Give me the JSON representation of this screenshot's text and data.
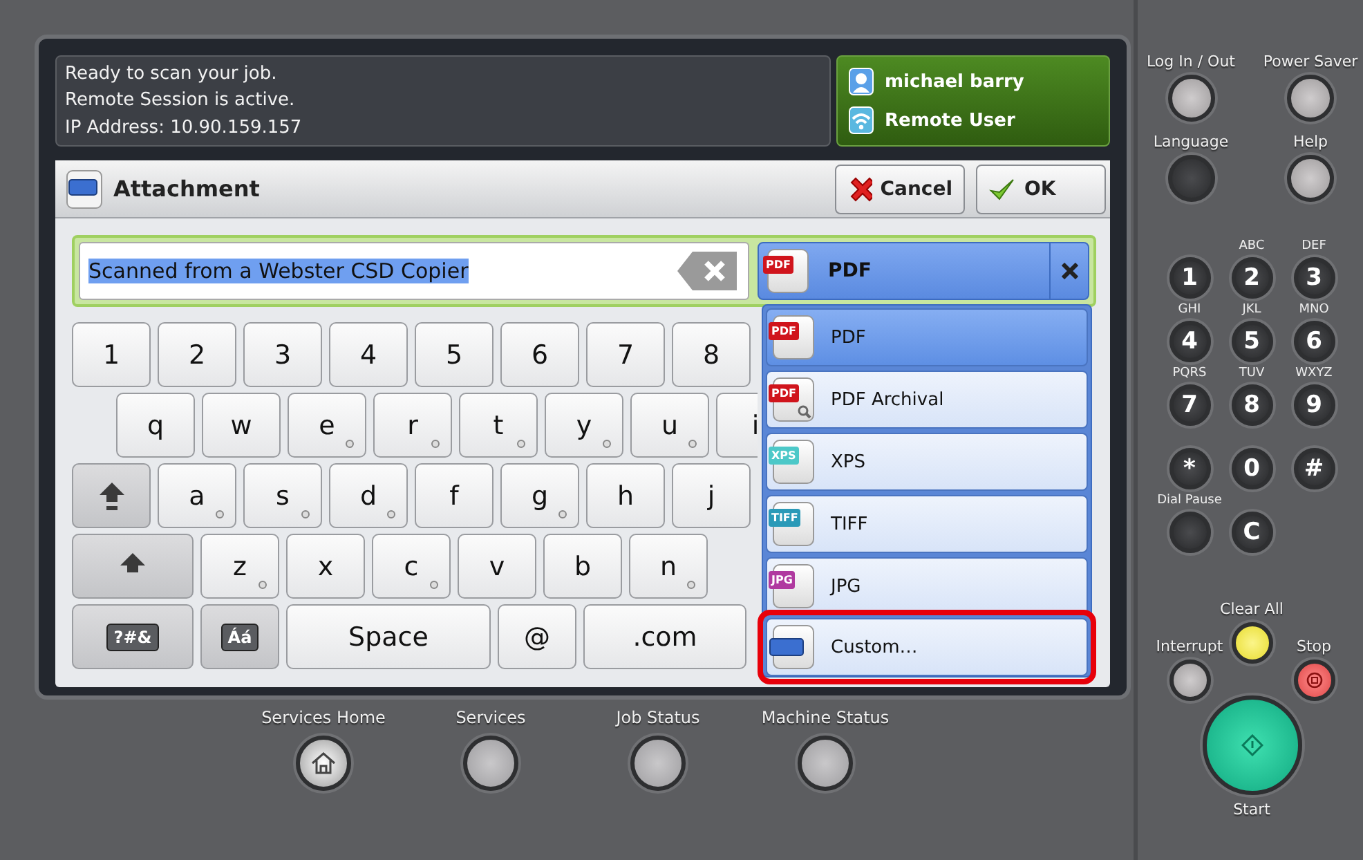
{
  "status": {
    "lines": [
      "Ready to scan your job.",
      "Remote Session is active.",
      "IP Address: 10.90.159.157"
    ]
  },
  "user": {
    "name": "michael barry",
    "role": "Remote User"
  },
  "dialog": {
    "title": "Attachment",
    "buttons": [
      {
        "label": "Cancel",
        "kind": "cancel"
      },
      {
        "label": "OK",
        "kind": "ok"
      }
    ]
  },
  "filename": {
    "value": "Scanned from a Webster CSD Copier",
    "selected": true
  },
  "format": {
    "value": "PDF",
    "badge": "PDF",
    "kind": "pdf"
  },
  "format_options": [
    {
      "label": "PDF",
      "badge": "PDF",
      "kind": "pdf",
      "selected": true,
      "highlighted": false
    },
    {
      "label": "PDF Archival",
      "badge": "PDF",
      "kind": "pdf-archival",
      "selected": false,
      "highlighted": false
    },
    {
      "label": "XPS",
      "badge": "XPS",
      "kind": "xps",
      "selected": false,
      "highlighted": false
    },
    {
      "label": "TIFF",
      "badge": "TIFF",
      "kind": "tiff",
      "selected": false,
      "highlighted": false
    },
    {
      "label": "JPG",
      "badge": "JPG",
      "kind": "jpg",
      "selected": false,
      "highlighted": false
    },
    {
      "label": "Custom…",
      "kind": "custom",
      "selected": false,
      "highlighted": true
    }
  ],
  "keyboard": [
    {
      "keys": [
        {
          "label": "1"
        },
        {
          "label": "2"
        },
        {
          "label": "3"
        },
        {
          "label": "4"
        },
        {
          "label": "5"
        },
        {
          "label": "6"
        },
        {
          "label": "7"
        },
        {
          "label": "8"
        }
      ]
    },
    {
      "keys": [
        {
          "label": "q"
        },
        {
          "label": "w"
        },
        {
          "label": "e",
          "accent": true
        },
        {
          "label": "r",
          "accent": true
        },
        {
          "label": "t",
          "accent": true
        },
        {
          "label": "y",
          "accent": true
        },
        {
          "label": "u",
          "accent": true
        },
        {
          "label": "i"
        }
      ]
    },
    {
      "keys": [
        {
          "kind": "shift-lock"
        },
        {
          "label": "a",
          "accent": true
        },
        {
          "label": "s",
          "accent": true
        },
        {
          "label": "d",
          "accent": true
        },
        {
          "label": "f"
        },
        {
          "label": "g",
          "accent": true
        },
        {
          "label": "h"
        },
        {
          "label": "j"
        }
      ]
    },
    {
      "keys": [
        {
          "kind": "shift"
        },
        {
          "label": "z",
          "accent": true
        },
        {
          "label": "x"
        },
        {
          "label": "c",
          "accent": true
        },
        {
          "label": "v"
        },
        {
          "label": "b"
        },
        {
          "label": "n",
          "accent": true
        }
      ]
    },
    {
      "keys": [
        {
          "label": "?#&",
          "kind": "symbols"
        },
        {
          "label": "Áá",
          "kind": "accents"
        },
        {
          "label": "Space",
          "kind": "space"
        },
        {
          "label": "@"
        },
        {
          "label": ".com",
          "kind": "domain"
        }
      ]
    }
  ],
  "top_buttons": [
    {
      "label": "Log In / Out",
      "kind": "light"
    },
    {
      "label": "Power Saver",
      "kind": "light"
    },
    {
      "label": "Language",
      "kind": "dark"
    },
    {
      "label": "Help",
      "kind": "light"
    }
  ],
  "keypad": [
    {
      "key": "1"
    },
    {
      "key": "2",
      "letters": "ABC"
    },
    {
      "key": "3",
      "letters": "DEF"
    },
    {
      "key": "4",
      "letters": "GHI"
    },
    {
      "key": "5",
      "letters": "JKL"
    },
    {
      "key": "6",
      "letters": "MNO"
    },
    {
      "key": "7",
      "letters": "PQRS"
    },
    {
      "key": "8",
      "letters": "TUV"
    },
    {
      "key": "9",
      "letters": "WXYZ"
    },
    {
      "key": "*"
    },
    {
      "key": "0"
    },
    {
      "key": "#"
    },
    {
      "letters": "Dial Pause"
    },
    {
      "key": "C"
    }
  ],
  "action_buttons": [
    {
      "label": "Interrupt",
      "kind": "interrupt"
    },
    {
      "label": "Clear All",
      "kind": "clear"
    },
    {
      "label": "Stop",
      "kind": "stop"
    },
    {
      "label": "Start",
      "kind": "start"
    }
  ],
  "bottom_buttons": [
    {
      "label": "Services Home",
      "kind": "home"
    },
    {
      "label": "Services",
      "kind": "plain"
    },
    {
      "label": "Job Status",
      "kind": "plain"
    },
    {
      "label": "Machine Status",
      "kind": "plain"
    }
  ]
}
